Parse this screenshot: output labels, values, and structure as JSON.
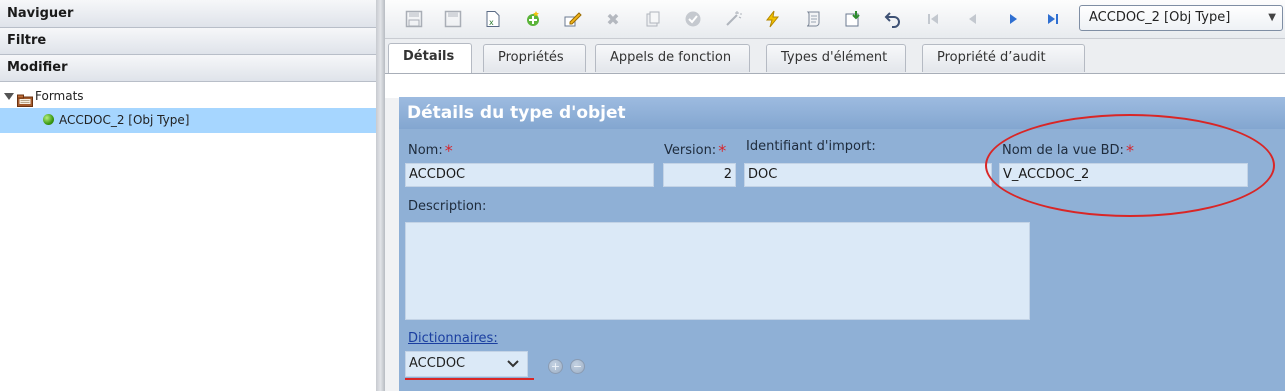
{
  "left_panel": {
    "sections": [
      "Naviguer",
      "Filtre",
      "Modifier"
    ],
    "tree": {
      "root_label": "Formats",
      "selected_item_label": "ACCDOC_2 [Obj Type]"
    }
  },
  "toolbar": {
    "object_selector_value": "ACCDOC_2 [Obj Type]",
    "icons": [
      "save-as-icon",
      "save-icon",
      "export-icon",
      "new-icon",
      "edit-icon",
      "delete-icon",
      "copy-icon",
      "validate-icon",
      "generate-icon",
      "run-icon",
      "script-icon",
      "download-icon",
      "undo-icon",
      "first-page-icon",
      "previous-page-icon",
      "next-page-icon",
      "last-page-icon"
    ]
  },
  "tabs": [
    "Détails",
    "Propriétés",
    "Appels de fonction",
    "Types d'élément",
    "Propriété d’audit"
  ],
  "form": {
    "title": "Détails du type d'objet",
    "name_label": "Nom:",
    "name_value": "ACCDOC",
    "version_label": "Version:",
    "version_value": "2",
    "import_id_label": "Identifiant d'import:",
    "import_id_value": "DOC",
    "db_view_label": "Nom de la vue BD:",
    "db_view_value": "V_ACCDOC_2",
    "description_label": "Description:",
    "description_value": "",
    "dictionaries_label": "Dictionnaires:",
    "dictionaries_value": "ACCDOC",
    "required_mark": "*",
    "add_symbol": "+",
    "remove_symbol": "−"
  },
  "colors": {
    "panel_bg": "#8fb0d6",
    "field_bg": "#dbe9f7",
    "selection_bg": "#a6d6ff",
    "annotation_red": "#d92626"
  }
}
